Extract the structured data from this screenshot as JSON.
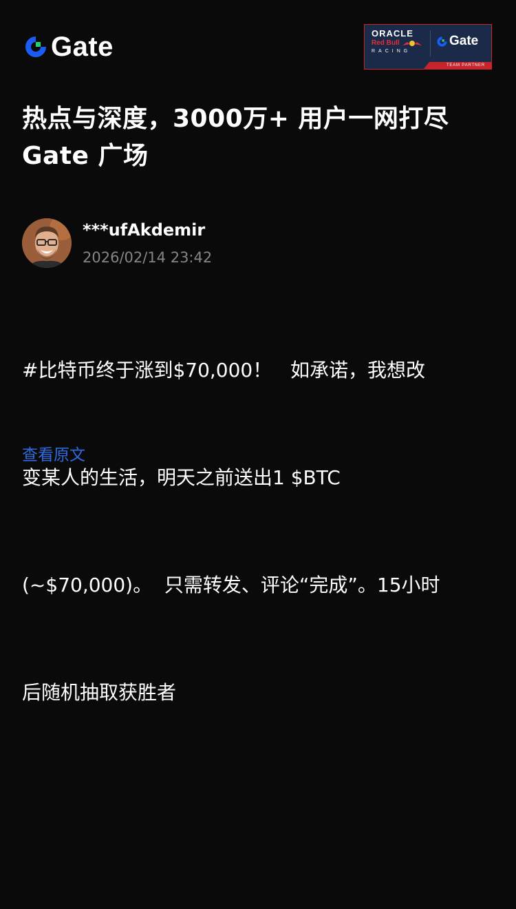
{
  "header": {
    "logo_text": "Gate",
    "logo_icon": "gate-logo-icon",
    "partner": {
      "oracle": "ORACLE",
      "red_bull": "Red Bull",
      "racing": "RACING",
      "gate_text": "Gate",
      "strip": "TEAM PARTNER"
    }
  },
  "headline": {
    "line1": "热点与深度，3000万+ 用户一网打尽",
    "line2": "Gate 广场"
  },
  "post": {
    "author": "***ufAkdemir",
    "timestamp": "2026/02/14 23:42",
    "body_lines": [
      "#比特币终于涨到$70,000！   如承诺，我想改",
      "变某人的生活，明天之前送出1 $BTC",
      "(~$70,000)。  只需转发、评论“完成”。15小时",
      "后随机抽取获胜者"
    ],
    "view_original": "查看原文"
  },
  "colors": {
    "background": "#0a0a0a",
    "link": "#2f6be0",
    "muted": "#84868a",
    "brand_green": "#1fd17c",
    "brand_blue": "#1b5cf5"
  }
}
